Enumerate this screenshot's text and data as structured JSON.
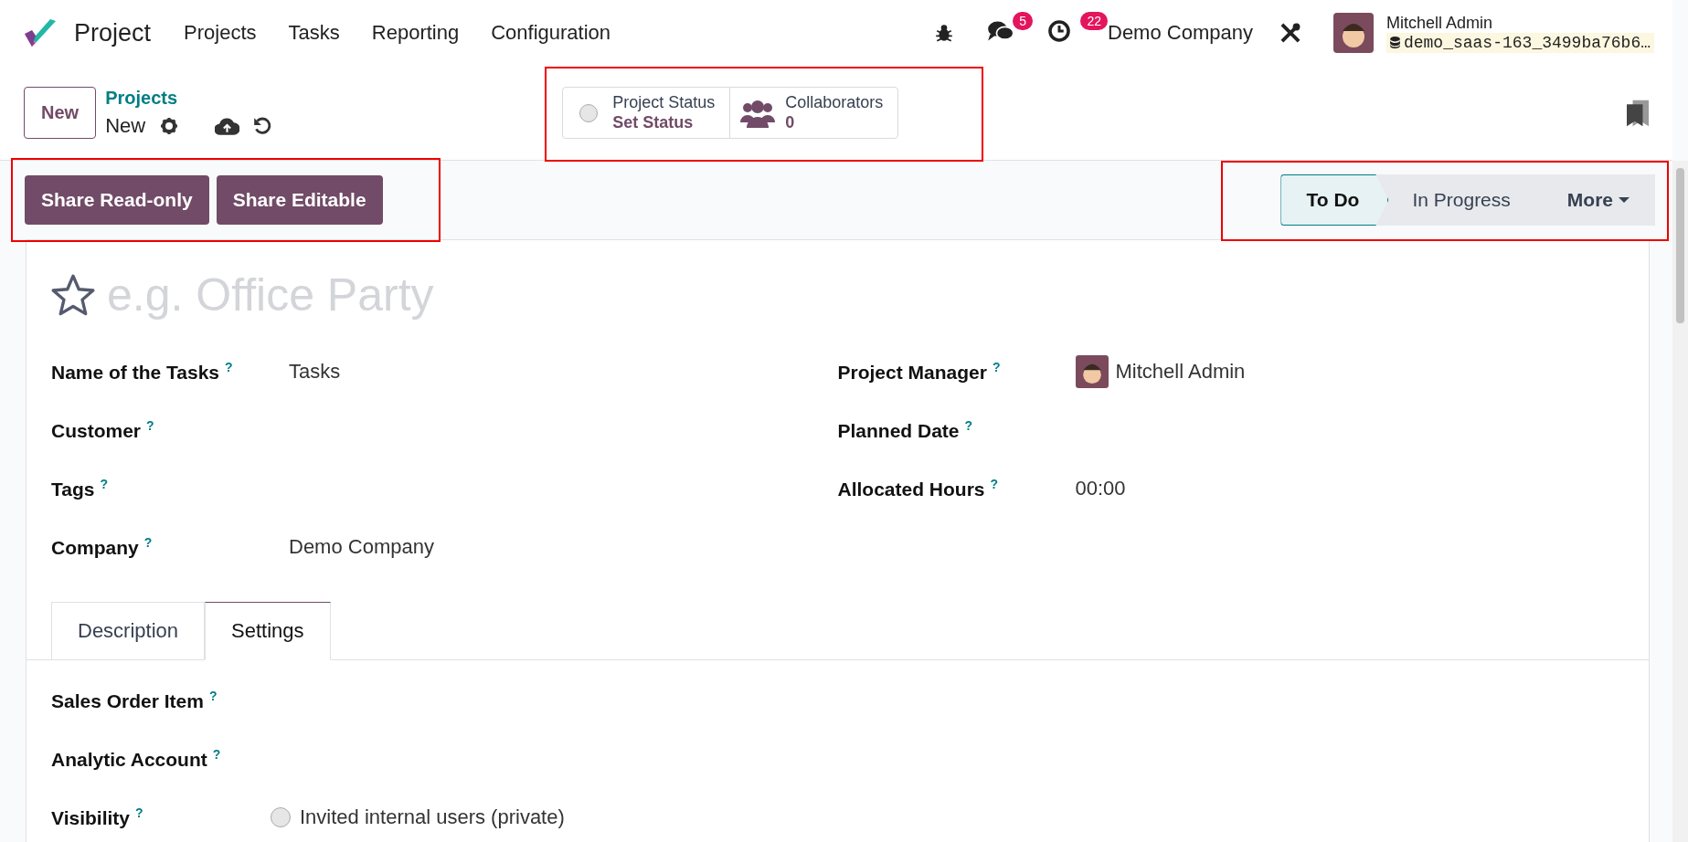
{
  "navbar": {
    "app_name": "Project",
    "menu": [
      "Projects",
      "Tasks",
      "Reporting",
      "Configuration"
    ],
    "messages_badge": "5",
    "activities_badge": "22",
    "company": "Demo Company",
    "user": {
      "name": "Mitchell Admin",
      "database": "demo_saas-163_3499ba76b6…"
    }
  },
  "control_panel": {
    "new_button": "New",
    "breadcrumb": "Projects",
    "record": "New",
    "status": {
      "label": "Project Status",
      "value": "Set Status"
    },
    "collaborators": {
      "label": "Collaborators",
      "count": "0"
    }
  },
  "actions": [
    "Share Read-only",
    "Share Editable"
  ],
  "stages": [
    {
      "label": "To Do",
      "selected": true
    },
    {
      "label": "In Progress",
      "selected": false
    }
  ],
  "more_stages": "More",
  "form": {
    "name_placeholder": "e.g. Office Party",
    "favorite": false,
    "left_fields": [
      {
        "label": "Name of the Tasks",
        "help": "?",
        "value": "Tasks"
      },
      {
        "label": "Customer",
        "help": "?"
      },
      {
        "label": "Tags",
        "help": "?"
      },
      {
        "label": "Company",
        "help": "?",
        "value": "Demo Company"
      }
    ],
    "right_fields": [
      {
        "label": "Project Manager",
        "help": "?",
        "value": "Mitchell Admin",
        "kind": "user"
      },
      {
        "label": "Planned Date",
        "help": "?",
        "kind": "text"
      },
      {
        "label": "Allocated Hours",
        "help": "?",
        "value": "00:00",
        "kind": "text"
      }
    ],
    "tabs": [
      {
        "label": "Description",
        "selected": false
      },
      {
        "label": "Settings",
        "selected": true
      }
    ],
    "settings_fields": [
      {
        "label": "Sales Order Item",
        "help": "?",
        "kind": "text"
      },
      {
        "label": "Analytic Account",
        "help": "?",
        "kind": "text"
      },
      {
        "label": "Visibility",
        "help": "?",
        "kind": "radio",
        "option": "Invited internal users (private)",
        "checked": false
      }
    ]
  }
}
